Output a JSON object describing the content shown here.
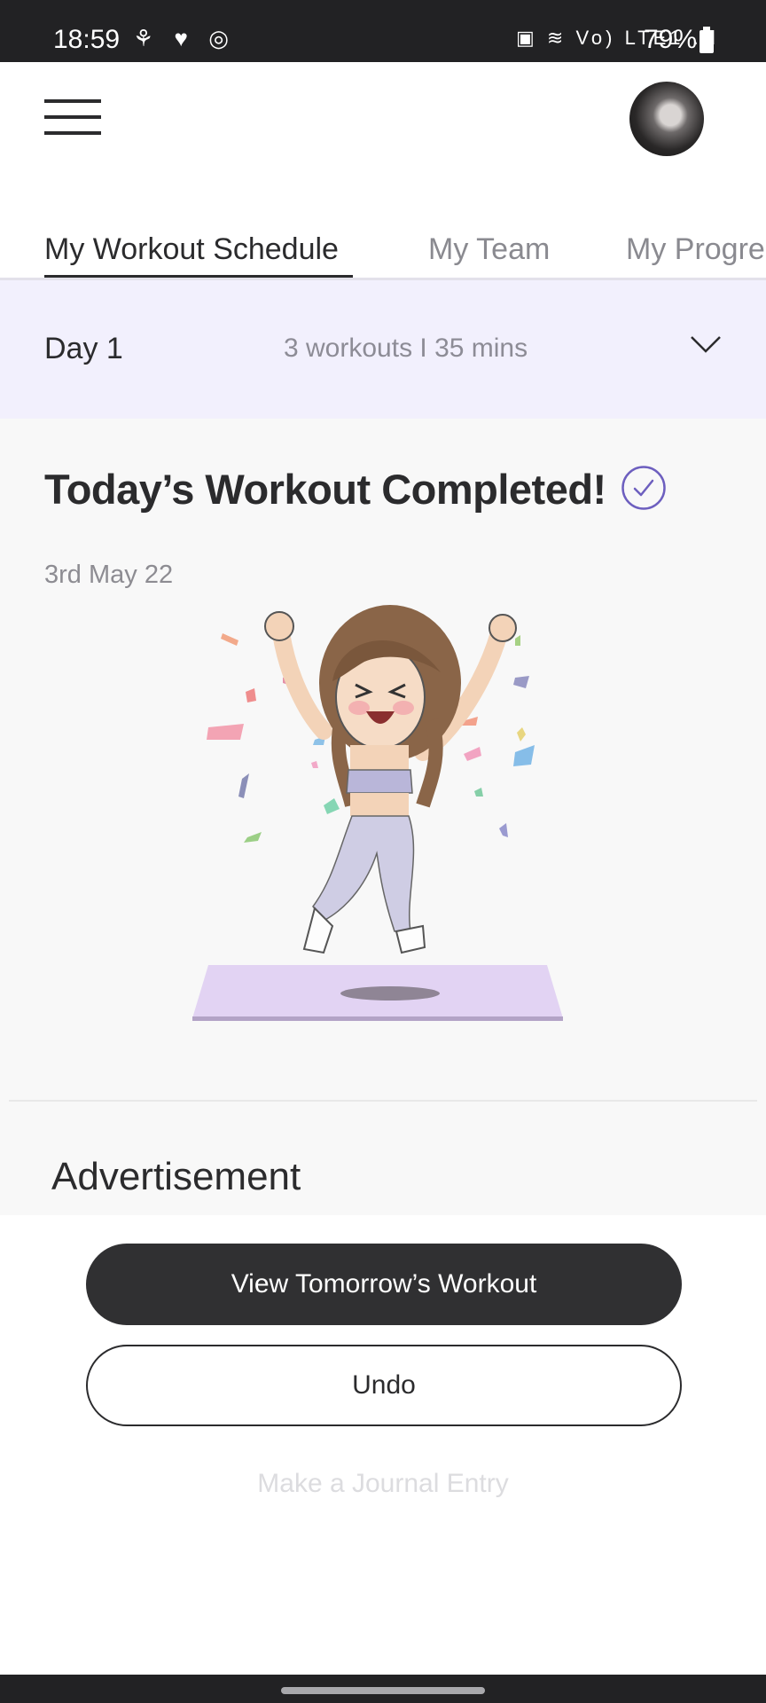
{
  "status_bar": {
    "time": "18:59",
    "left_icons": "⚘ ♥ ◎",
    "right_icons": "▣ ≋ Vo) LTE1 .ıl",
    "battery": "79%"
  },
  "header": {
    "menu_icon": "hamburger-icon",
    "avatar_icon": "user-avatar"
  },
  "tabs": [
    {
      "label": "My Workout Schedule",
      "active": true
    },
    {
      "label": "My Team",
      "active": false
    },
    {
      "label": "My Progre",
      "active": false
    }
  ],
  "day_row": {
    "day": "Day 1",
    "summary": "3 workouts I 35 mins",
    "chevron_icon": "chevron-down-icon"
  },
  "completion": {
    "title": "Today’s Workout Completed!",
    "check_icon": "check-circle-icon",
    "date": "3rd May 22",
    "illustration": "celebration-illustration"
  },
  "advertisement": {
    "title": "Advertisement"
  },
  "actions": {
    "primary_label": "View Tomorrow’s Workout",
    "secondary_label": "Undo",
    "journal_label": "Make a Journal Entry"
  },
  "colors": {
    "accent": "#6d5fbf",
    "day_row_bg": "#f2f0fd",
    "primary_button": "#303032",
    "mat": "#e2d3f3"
  }
}
